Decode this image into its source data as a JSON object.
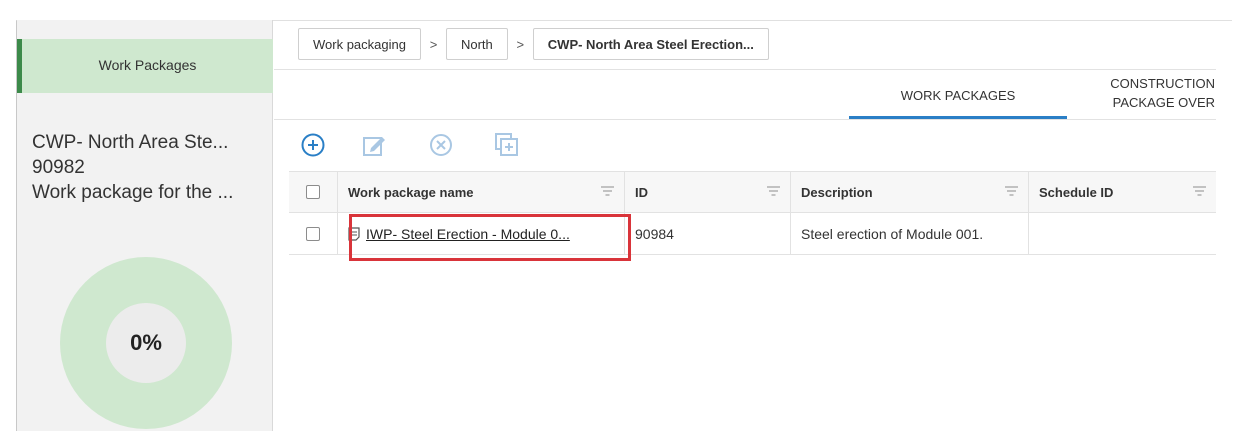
{
  "sidebar": {
    "tab_label": "Work Packages",
    "package_name": "CWP- North Area Ste...",
    "package_id": "90982",
    "package_description": "Work package for the ...",
    "progress_label": "0%"
  },
  "breadcrumb": {
    "items": [
      "Work packaging",
      "North",
      "CWP- North Area Steel Erection..."
    ],
    "separator": ">"
  },
  "tabs": {
    "work_packages": "WORK PACKAGES",
    "construction_line1": "CONSTRUCTION",
    "construction_line2": "PACKAGE OVER"
  },
  "toolbar": {
    "icons": [
      "add-icon",
      "edit-icon",
      "delete-icon",
      "copy-icon"
    ],
    "accent": "#2a7fc6",
    "disabled": "#a9c7e3"
  },
  "table": {
    "headers": [
      "Work package name",
      "ID",
      "Description",
      "Schedule ID"
    ],
    "rows": [
      {
        "name": "IWP- Steel Erection - Module 0...",
        "id": "90984",
        "description": "Steel erection of Module 001.",
        "schedule_id": ""
      }
    ]
  },
  "colors": {
    "sidebar_green": "#cfe8cf",
    "sidebar_accent": "#3c8a4a",
    "highlight": "#d9343a"
  }
}
